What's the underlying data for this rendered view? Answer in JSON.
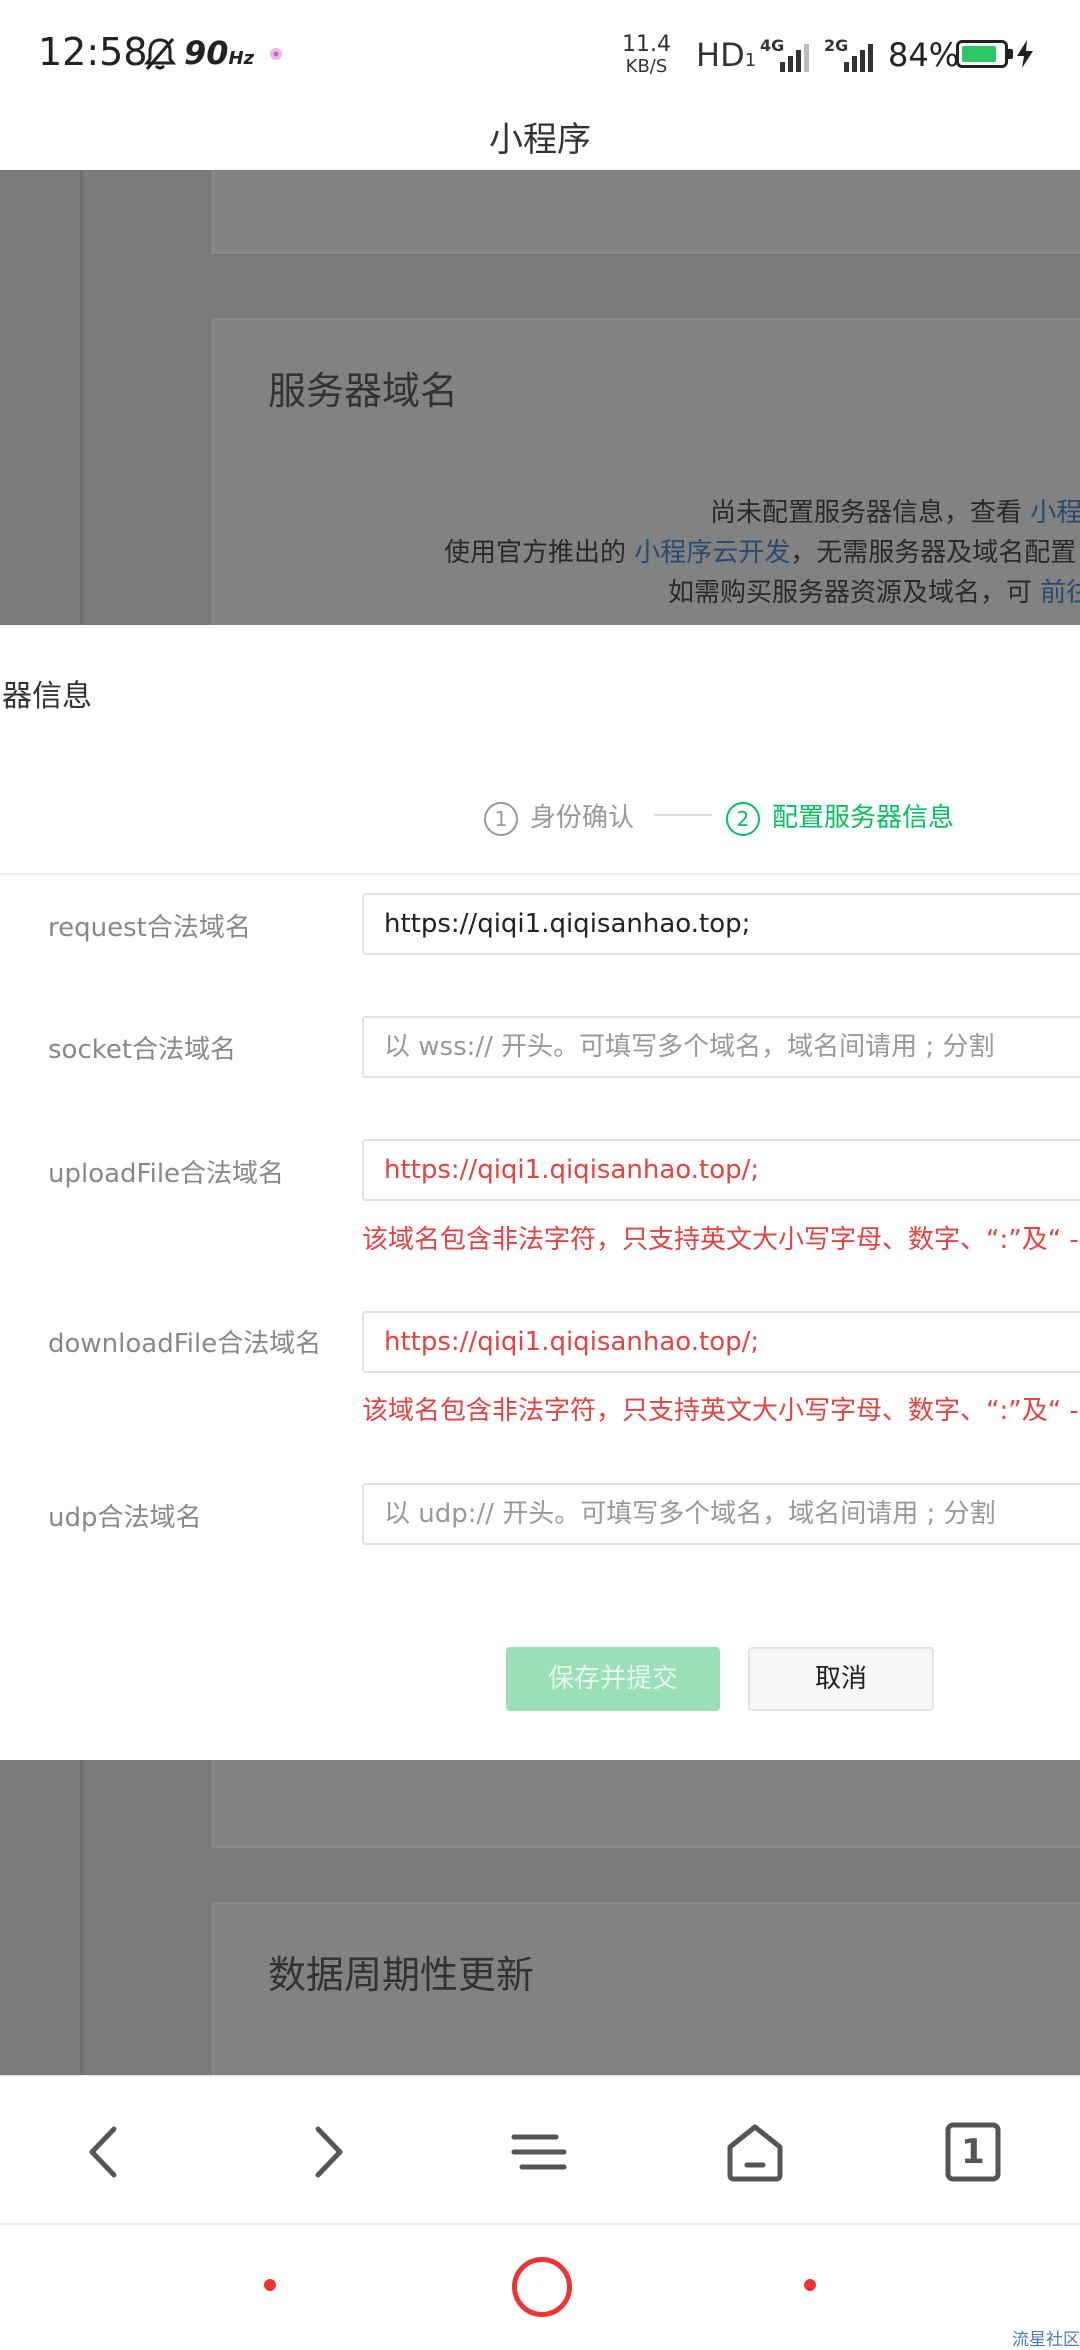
{
  "status_bar": {
    "time": "12:58",
    "refresh_rate": "90",
    "refresh_unit": "Hz",
    "speed_value": "11.4",
    "speed_unit": "KB/S",
    "hd": "HD",
    "hd_sub": "1",
    "net1": "4G",
    "net2": "2G",
    "battery_percent": "84%",
    "battery_level": 0.84,
    "battery_color": "#2ec766"
  },
  "page_title": "小程序",
  "background": {
    "section_server": "服务器域名",
    "line1": "尚未配置服务器信息，查看 ",
    "line1_link": "小程",
    "line2_pre": "使用官方推出的 ",
    "line2_link": "小程序云开发",
    "line2_post": "，无需服务器及域名配置",
    "line3": "如需购买服务器资源及域名，可 ",
    "line3_link": "前往",
    "section_data": "数据周期性更新"
  },
  "modal": {
    "title": "器信息",
    "steps": [
      {
        "num": "1",
        "label": "身份确认"
      },
      {
        "num": "2",
        "label": "配置服务器信息"
      }
    ],
    "fields": [
      {
        "label": "request合法域名",
        "value": "https://qiqi1.qiqisanhao.top;"
      },
      {
        "label": "socket合法域名",
        "placeholder": "以 wss:// 开头。可填写多个域名，域名间请用 ; 分割"
      },
      {
        "label": "uploadFile合法域名",
        "value": "https://qiqi1.qiqisanhao.top/;",
        "error": "该域名包含非法字符，只支持英文大小写字母、数字、“:”及“ - ”"
      },
      {
        "label": "downloadFile合法域名",
        "value": "https://qiqi1.qiqisanhao.top/;",
        "error": "该域名包含非法字符，只支持英文大小写字母、数字、“:”及“ - ”"
      },
      {
        "label": "udp合法域名",
        "placeholder": "以 udp:// 开头。可填写多个域名，域名间请用 ; 分割"
      }
    ],
    "save_label": "保存并提交",
    "cancel_label": "取消",
    "accent_color": "#07c160",
    "error_color": "#e64340"
  },
  "browser_nav": {
    "tab_count": "1"
  },
  "watermark": "流星社区"
}
